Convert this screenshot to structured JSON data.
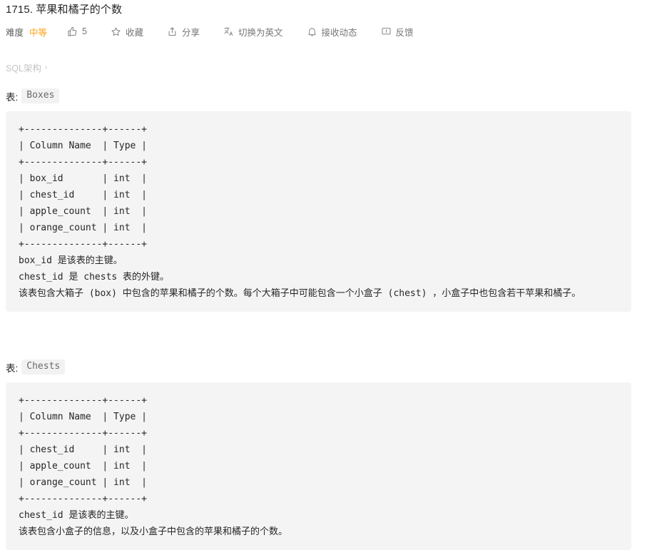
{
  "problem": {
    "title": "1715. 苹果和橘子的个数"
  },
  "meta": {
    "difficulty_label": "难度",
    "difficulty_value": "中等",
    "like_icon": "thumbs-up-icon",
    "like_count": "5",
    "favorite_icon": "star-icon",
    "favorite_label": "收藏",
    "share_icon": "share-icon",
    "share_label": "分享",
    "translate_icon": "translate-icon",
    "translate_label": "切换为英文",
    "subscribe_icon": "bell-icon",
    "subscribe_label": "接收动态",
    "feedback_icon": "feedback-icon",
    "feedback_label": "反馈"
  },
  "breadcrumb": {
    "label": "SQL架构",
    "chevron": "›"
  },
  "sections": [
    {
      "heading_label": "表:",
      "table_name": "Boxes",
      "code": "+--------------+------+\n| Column Name  | Type |\n+--------------+------+\n| box_id       | int  |\n| chest_id     | int  |\n| apple_count  | int  |\n| orange_count | int  |\n+--------------+------+",
      "notes": [
        "box_id 是该表的主键。",
        "chest_id 是 chests 表的外键。"
      ],
      "description": "该表包含大箱子 (box) 中包含的苹果和橘子的个数。每个大箱子中可能包含一个小盒子 (chest) ，小盒子中也包含若干苹果和橘子。"
    },
    {
      "heading_label": "表:",
      "table_name": "Chests",
      "code": "+--------------+------+\n| Column Name  | Type |\n+--------------+------+\n| chest_id     | int  |\n| apple_count  | int  |\n| orange_count | int  |\n+--------------+------+",
      "notes": [
        "chest_id 是该表的主键。"
      ],
      "description": "该表包含小盒子的信息，以及小盒子中包含的苹果和橘子的个数。"
    }
  ],
  "colors": {
    "difficulty_medium": "#ffa116",
    "code_background": "#f4f4f4",
    "chip_background": "#f2f2f2",
    "text_primary": "#262626",
    "text_muted": "#767676",
    "breadcrumb": "#c4c4c4"
  }
}
